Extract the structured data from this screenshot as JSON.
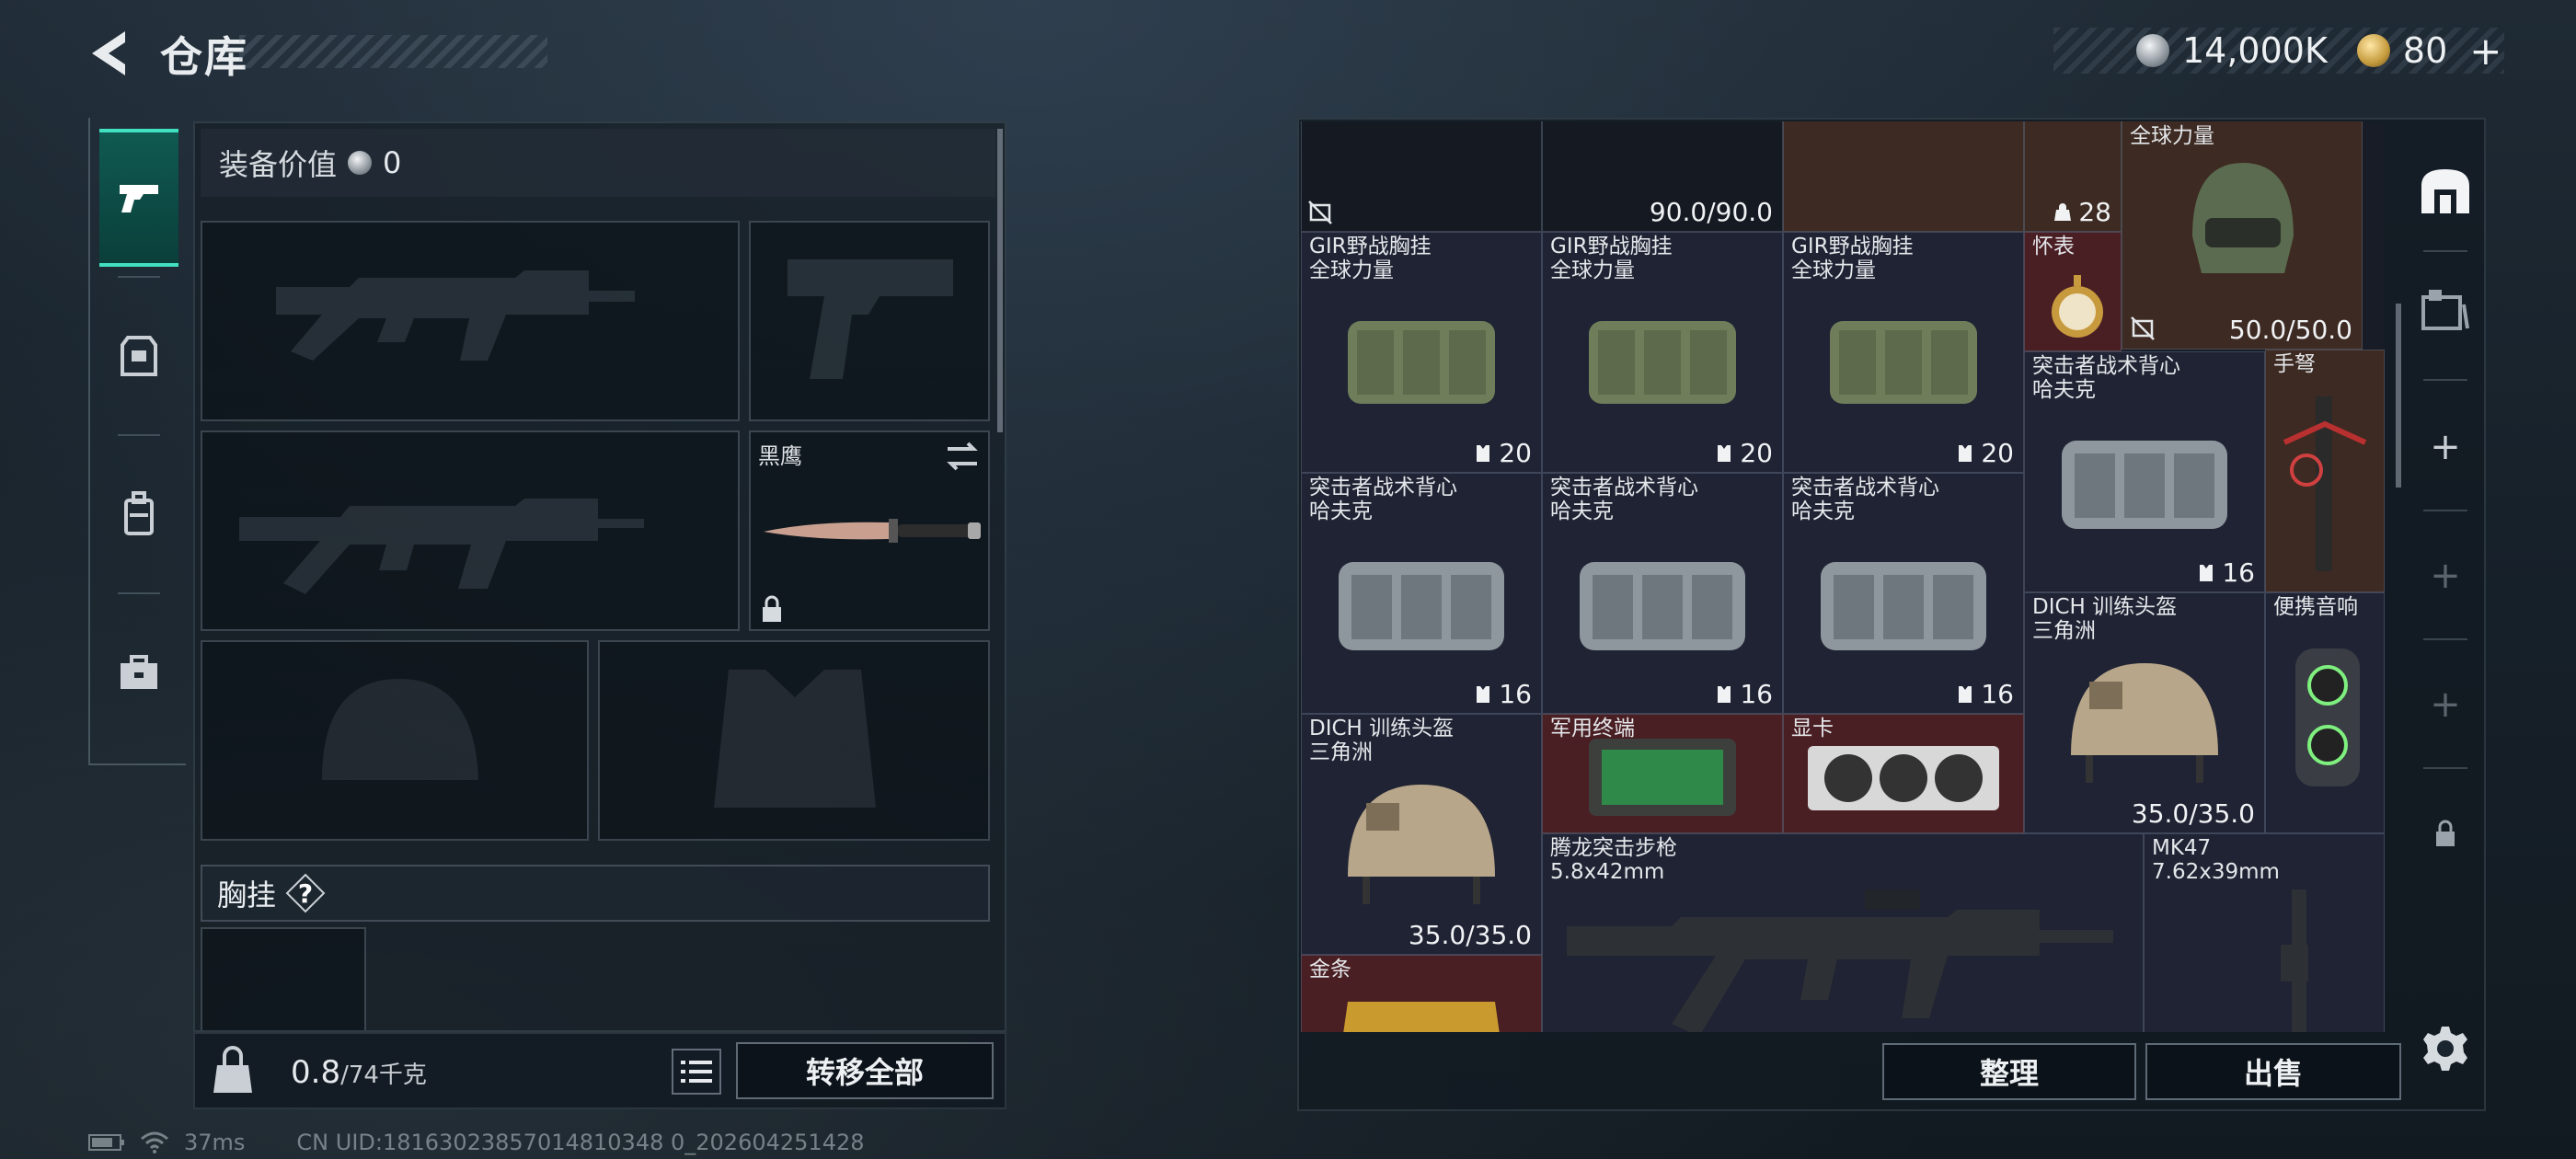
{
  "header": {
    "title": "仓库"
  },
  "currency": {
    "silver": "14,000K",
    "gold": "80",
    "plus": "+"
  },
  "left_nav": {
    "items": [
      "pistol-icon",
      "armor-icon",
      "backpack-icon",
      "briefcase-icon"
    ]
  },
  "equipment": {
    "value_label": "装备价值",
    "value": "0",
    "melee_slot_label": "黑鹰",
    "chest_rig_section": "胸挂",
    "help": "?"
  },
  "footer_left": {
    "weight_current": "0.8",
    "weight_max": "/74千克",
    "transfer_all": "转移全部"
  },
  "status": {
    "ping": "37ms",
    "uid": "CN UID:18163023857014810348 0_202604251428"
  },
  "inventory": {
    "items": [
      {
        "name": "",
        "stat": "90.0/90.0"
      },
      {
        "name": "",
        "count": "28"
      },
      {
        "name": "全球力量",
        "stat": "50.0/50.0"
      },
      {
        "name": "GIR野战胸挂\n全球力量",
        "count": "20"
      },
      {
        "name": "GIR野战胸挂\n全球力量",
        "count": "20"
      },
      {
        "name": "GIR野战胸挂\n全球力量",
        "count": "20"
      },
      {
        "name": "怀表"
      },
      {
        "name": "突击者战术背心\n哈夫克",
        "count": "16"
      },
      {
        "name": "手弩"
      },
      {
        "name": "突击者战术背心\n哈夫克",
        "count": "16"
      },
      {
        "name": "突击者战术背心\n哈夫克",
        "count": "16"
      },
      {
        "name": "突击者战术背心\n哈夫克",
        "count": "16"
      },
      {
        "name": "DICH 训练头盔\n三角洲",
        "stat": "35.0/35.0"
      },
      {
        "name": "便携音响"
      },
      {
        "name": "DICH 训练头盔\n三角洲",
        "stat": "35.0/35.0"
      },
      {
        "name": "军用终端"
      },
      {
        "name": "显卡"
      },
      {
        "name": "腾龙突击步枪\n5.8x42mm"
      },
      {
        "name": "MK47\n7.62x39mm"
      },
      {
        "name": "金条"
      }
    ]
  },
  "actions": {
    "sort": "整理",
    "sell": "出售"
  },
  "side_nav": {
    "plus": "+"
  },
  "colors": {
    "accent": "#40e0c0",
    "red_item": "#4a1f24",
    "brown_item": "#3d2a22"
  }
}
